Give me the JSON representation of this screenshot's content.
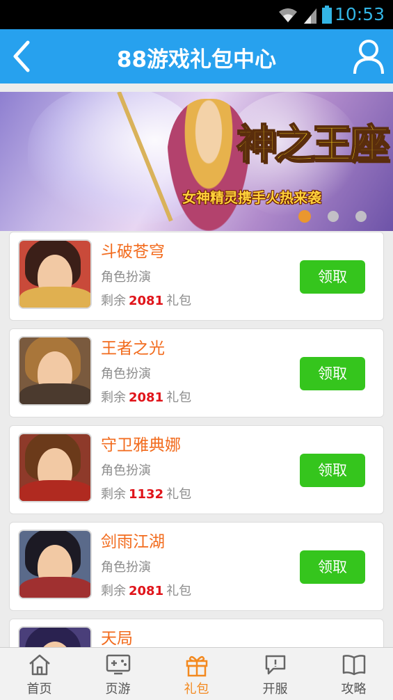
{
  "status_bar": {
    "time": "10:53"
  },
  "header": {
    "title": "88游戏礼包中心",
    "back_icon": "chevron-left-icon",
    "user_icon": "user-icon"
  },
  "banner": {
    "logo_text": "神之王座",
    "slogan": "女神精灵携手火热来袭",
    "page_count": 3,
    "active_page": 1
  },
  "games": [
    {
      "name": "斗破苍穹",
      "type": "角色扮演",
      "remain_prefix": "剩余",
      "remain_count": "2081",
      "remain_suffix": "礼包",
      "button": "领取"
    },
    {
      "name": "王者之光",
      "type": "角色扮演",
      "remain_prefix": "剩余",
      "remain_count": "2081",
      "remain_suffix": "礼包",
      "button": "领取"
    },
    {
      "name": "守卫雅典娜",
      "type": "角色扮演",
      "remain_prefix": "剩余",
      "remain_count": "1132",
      "remain_suffix": "礼包",
      "button": "领取"
    },
    {
      "name": "剑雨江湖",
      "type": "角色扮演",
      "remain_prefix": "剩余",
      "remain_count": "2081",
      "remain_suffix": "礼包",
      "button": "领取"
    },
    {
      "name": "天局"
    }
  ],
  "tabs": [
    {
      "label": "首页",
      "icon": "home-icon",
      "active": false
    },
    {
      "label": "页游",
      "icon": "gamepad-icon",
      "active": false
    },
    {
      "label": "礼包",
      "icon": "gift-icon",
      "active": true
    },
    {
      "label": "开服",
      "icon": "chat-bubble-icon",
      "active": false
    },
    {
      "label": "攻略",
      "icon": "book-icon",
      "active": false
    }
  ],
  "colors": {
    "primary": "#27a1ee",
    "accent": "#f26b1d",
    "button": "#35c51d",
    "count": "#e0141a",
    "tab_active": "#f3891f"
  }
}
